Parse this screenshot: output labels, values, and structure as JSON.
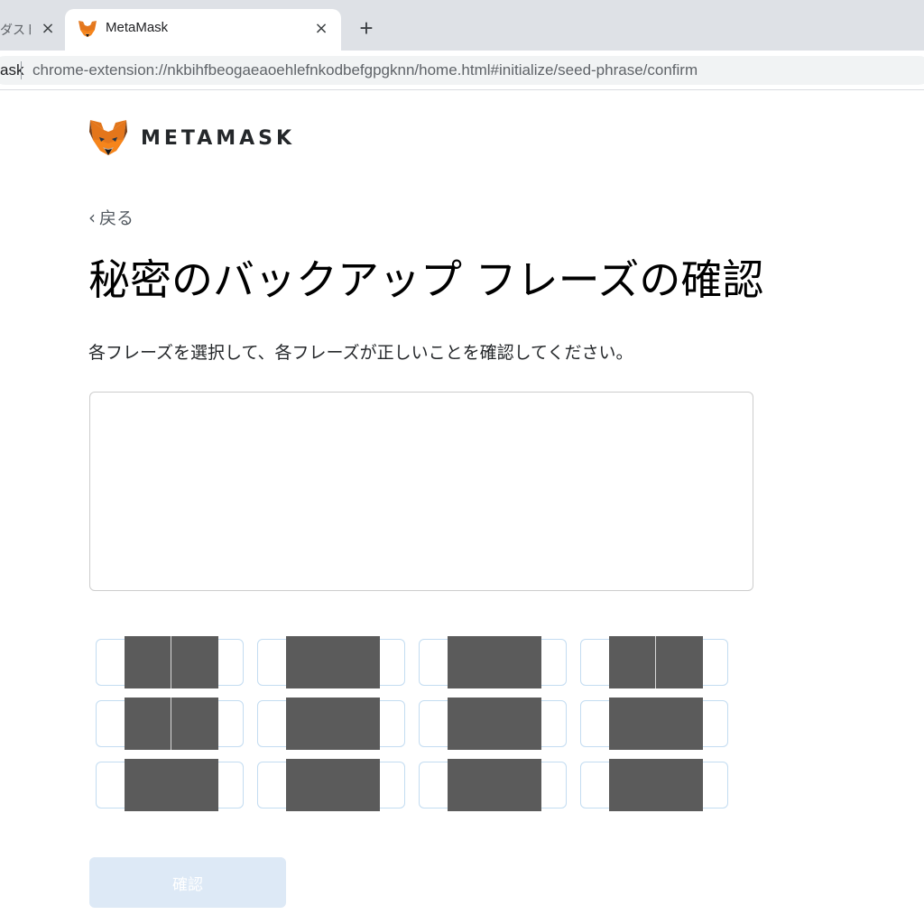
{
  "browser": {
    "tabs": [
      {
        "title": "ダスト",
        "active": false
      },
      {
        "title": "MetaMask",
        "active": true
      }
    ],
    "close_glyph": "×",
    "new_tab_glyph": "+",
    "address_bar": {
      "origin": "ask",
      "url": "chrome-extension://nkbihfbeogaeaoehlefnkodbefgpgknn/home.html#initialize/seed-phrase/confirm"
    }
  },
  "header": {
    "logo_icon": "metamask-fox-icon",
    "wordmark": "METAMASK"
  },
  "back_link": {
    "chevron": "‹",
    "label": "戻る"
  },
  "page_title": "秘密のバックアップ フレーズの確認",
  "instruction": "各フレーズを選択して、各フレーズが正しいことを確認してください。",
  "drop_area": {
    "selected_words": []
  },
  "word_chips": {
    "count": 12,
    "redacted": true,
    "mask_color": "#5b5b5b"
  },
  "confirm_button": {
    "label": "確認",
    "disabled": true
  },
  "colors": {
    "accent": "#037dd6",
    "chip_border": "#c3dcf1",
    "button_disabled_bg": "#dde9f6"
  }
}
